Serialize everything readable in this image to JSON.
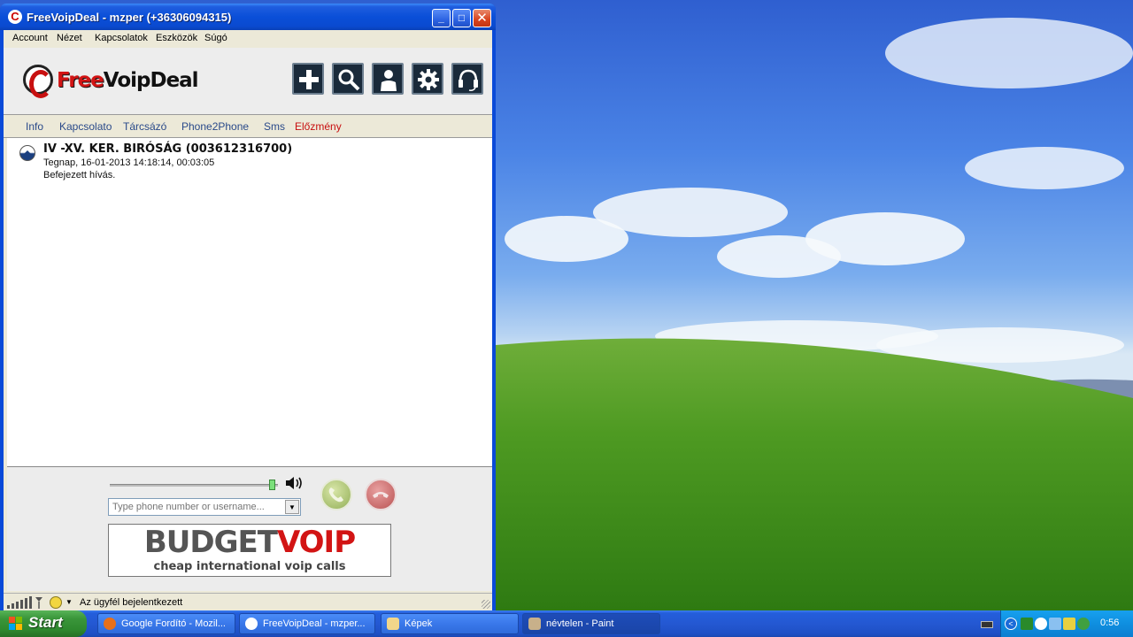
{
  "window": {
    "title": "FreeVoipDeal - mzper (+36306094315)",
    "min_label": "_",
    "max_label": "□",
    "close_label": "✕"
  },
  "menu": [
    "Account",
    "Nézet",
    "Kapcsolatok",
    "Eszközök",
    "Súgó"
  ],
  "brand": {
    "free": "Free",
    "rest": "VoipDeal"
  },
  "toolbar": [
    "add-icon",
    "search-icon",
    "contact-icon",
    "gear-icon",
    "headset-icon"
  ],
  "tabs": [
    "Info",
    "Kapcsolato",
    "Tárcsázó",
    "Phone2Phone",
    "Sms",
    "Előzmény"
  ],
  "active_tab": "Előzmény",
  "history": [
    {
      "name": "IV -XV. KER. BIRÓSÁG (003612316700)",
      "time": "Tegnap, 16-01-2013 14:18:14, 00:03:05",
      "status": "Befejezett hívás."
    }
  ],
  "dialer": {
    "volume_level": 0.97,
    "placeholder": "Type phone number or username...",
    "drop_label": "▼"
  },
  "ad": {
    "budget": "BUDGET",
    "voip": "VOIP",
    "sub": "cheap international voip calls"
  },
  "status": {
    "text": "Az ügyfél bejelentkezett",
    "drop_label": "▼"
  },
  "taskbar": {
    "start": "Start",
    "items": [
      {
        "label": "Google Fordító - Mozil..."
      },
      {
        "label": "FreeVoipDeal - mzper..."
      },
      {
        "label": "Képek"
      },
      {
        "label": "névtelen - Paint"
      }
    ],
    "tray_expand": "<",
    "clock": "0:56"
  },
  "colors": {
    "accent_red": "#c81010",
    "tab_blue": "#2a4a8a",
    "titlebar_blue": "#0a4fd8"
  }
}
